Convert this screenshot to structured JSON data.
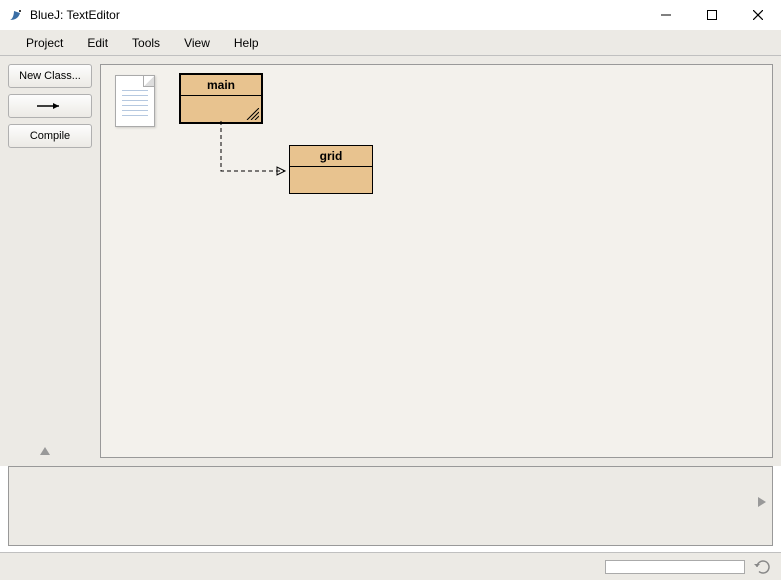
{
  "window": {
    "title": "BlueJ:  TextEditor"
  },
  "menu": {
    "project": "Project",
    "edit": "Edit",
    "tools": "Tools",
    "view": "View",
    "help": "Help"
  },
  "toolbar": {
    "new_class": "New Class...",
    "arrow_label": "→",
    "compile": "Compile"
  },
  "classes": {
    "main": {
      "name": "main"
    },
    "grid": {
      "name": "grid"
    }
  },
  "colors": {
    "class_fill": "#e8c38f",
    "panel_bg": "#eceae5",
    "diagram_bg": "#f3f1ec"
  }
}
